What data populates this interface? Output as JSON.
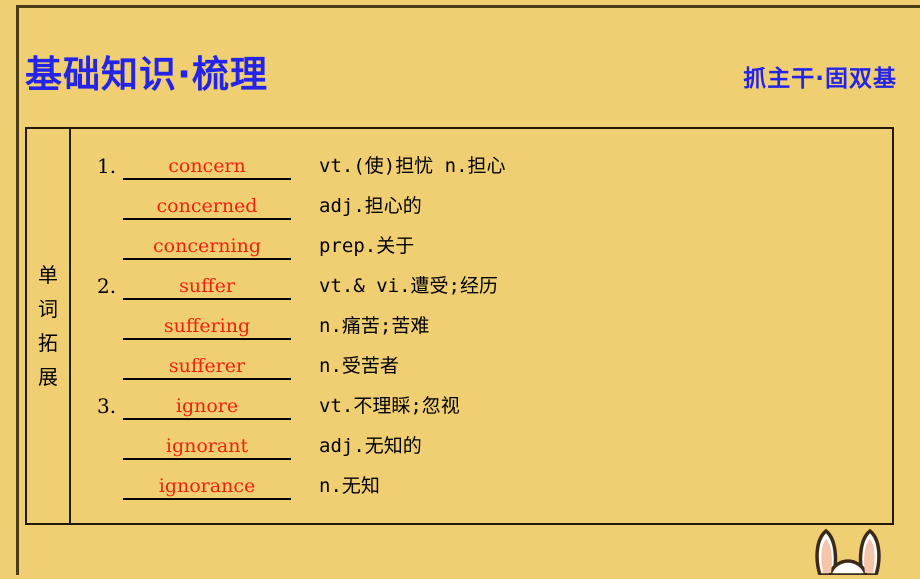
{
  "slide": {
    "background_color": "#f0cf72",
    "frame_color": "#4a3c18"
  },
  "header": {
    "title": "基础知识·梳理",
    "subtitle": "抓主干·固双基",
    "title_color": "#2424e8"
  },
  "table": {
    "section_label": "单词拓展",
    "border_color": "#211a08",
    "blank_color": "#ee2211",
    "definition_color": "#000000",
    "rows": [
      {
        "number": "1.",
        "word": "concern",
        "definition": "vt.(使)担忧 n.担心"
      },
      {
        "number": "",
        "word": "concerned",
        "definition": "adj.担心的"
      },
      {
        "number": "",
        "word": "concerning",
        "definition": "prep.关于"
      },
      {
        "number": "2.",
        "word": "suffer",
        "definition": "vt.& vi.遭受;经历"
      },
      {
        "number": "",
        "word": "suffering",
        "definition": "n.痛苦;苦难"
      },
      {
        "number": "",
        "word": "sufferer",
        "definition": "n.受苦者"
      },
      {
        "number": "3.",
        "word": "ignore",
        "definition": "vt.不理睬;忽视"
      },
      {
        "number": "",
        "word": "ignorant",
        "definition": "adj.无知的"
      },
      {
        "number": "",
        "word": "ignorance",
        "definition": "n.无知"
      }
    ]
  },
  "decoration": {
    "icon": "bunny-ears-icon",
    "outline_color": "#3b2a17",
    "fill_color": "#ffffff",
    "inner_color": "#f4c4ab"
  }
}
